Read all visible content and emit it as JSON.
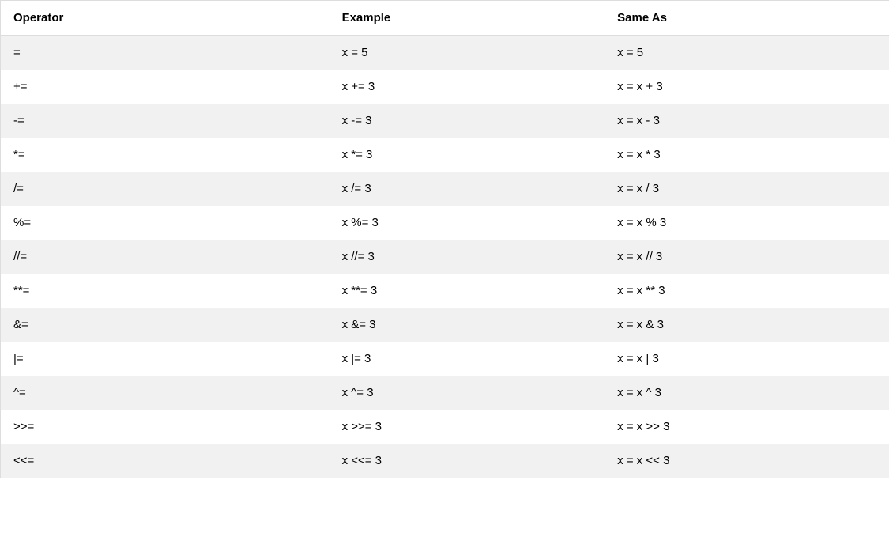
{
  "table": {
    "headers": {
      "operator": "Operator",
      "example": "Example",
      "sameas": "Same As"
    },
    "rows": [
      {
        "operator": "=",
        "example": "x = 5",
        "sameas": "x = 5"
      },
      {
        "operator": "+=",
        "example": "x += 3",
        "sameas": "x = x + 3"
      },
      {
        "operator": "-=",
        "example": "x -= 3",
        "sameas": "x = x - 3"
      },
      {
        "operator": "*=",
        "example": "x *= 3",
        "sameas": "x = x * 3"
      },
      {
        "operator": "/=",
        "example": "x /= 3",
        "sameas": "x = x / 3"
      },
      {
        "operator": "%=",
        "example": "x %= 3",
        "sameas": "x = x % 3"
      },
      {
        "operator": "//=",
        "example": "x //= 3",
        "sameas": "x = x // 3"
      },
      {
        "operator": "**=",
        "example": "x **= 3",
        "sameas": "x = x ** 3"
      },
      {
        "operator": "&=",
        "example": "x &= 3",
        "sameas": "x = x & 3"
      },
      {
        "operator": "|=",
        "example": "x |= 3",
        "sameas": "x = x | 3"
      },
      {
        "operator": "^=",
        "example": "x ^= 3",
        "sameas": "x = x ^ 3"
      },
      {
        "operator": ">>=",
        "example": "x >>= 3",
        "sameas": "x = x >> 3"
      },
      {
        "operator": "<<=",
        "example": "x <<= 3",
        "sameas": "x = x << 3"
      }
    ]
  }
}
